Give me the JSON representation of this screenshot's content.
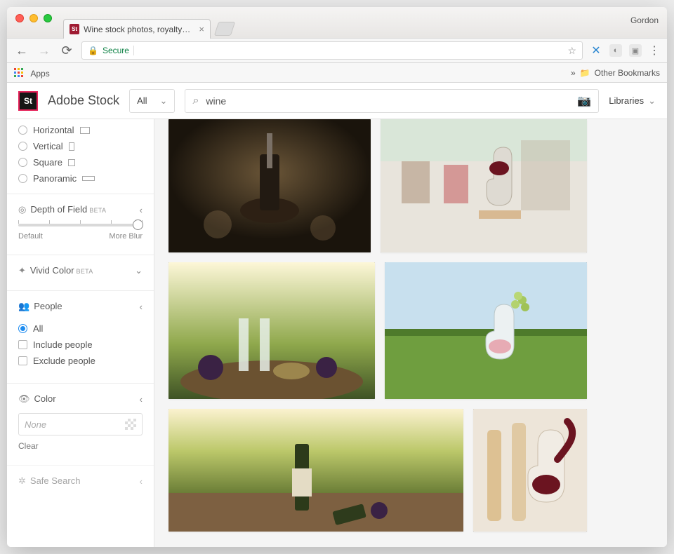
{
  "browser": {
    "profile_name": "Gordon",
    "tab_title": "Wine stock photos, royalty-fr…",
    "secure_label": "Secure",
    "apps_label": "Apps",
    "other_bookmarks": "Other Bookmarks",
    "bookmarks_overflow": "»"
  },
  "header": {
    "brand": "Adobe Stock",
    "logo_text": "St",
    "filter_selected": "All",
    "search_value": "wine",
    "libraries_label": "Libraries"
  },
  "sidebar": {
    "orientation": {
      "options": [
        {
          "label": "Horizontal",
          "glyph": "h"
        },
        {
          "label": "Vertical",
          "glyph": "v"
        },
        {
          "label": "Square",
          "glyph": "s"
        },
        {
          "label": "Panoramic",
          "glyph": "p"
        }
      ]
    },
    "depth_of_field": {
      "title": "Depth of Field",
      "beta": "BETA",
      "min_label": "Default",
      "max_label": "More Blur"
    },
    "vivid_color": {
      "title": "Vivid Color",
      "beta": "BETA"
    },
    "people": {
      "title": "People",
      "options": [
        "All",
        "Include people",
        "Exclude people"
      ],
      "selected": 0
    },
    "color": {
      "title": "Color",
      "placeholder": "None",
      "clear_label": "Clear"
    },
    "safe_search": {
      "title": "Safe Search"
    }
  }
}
